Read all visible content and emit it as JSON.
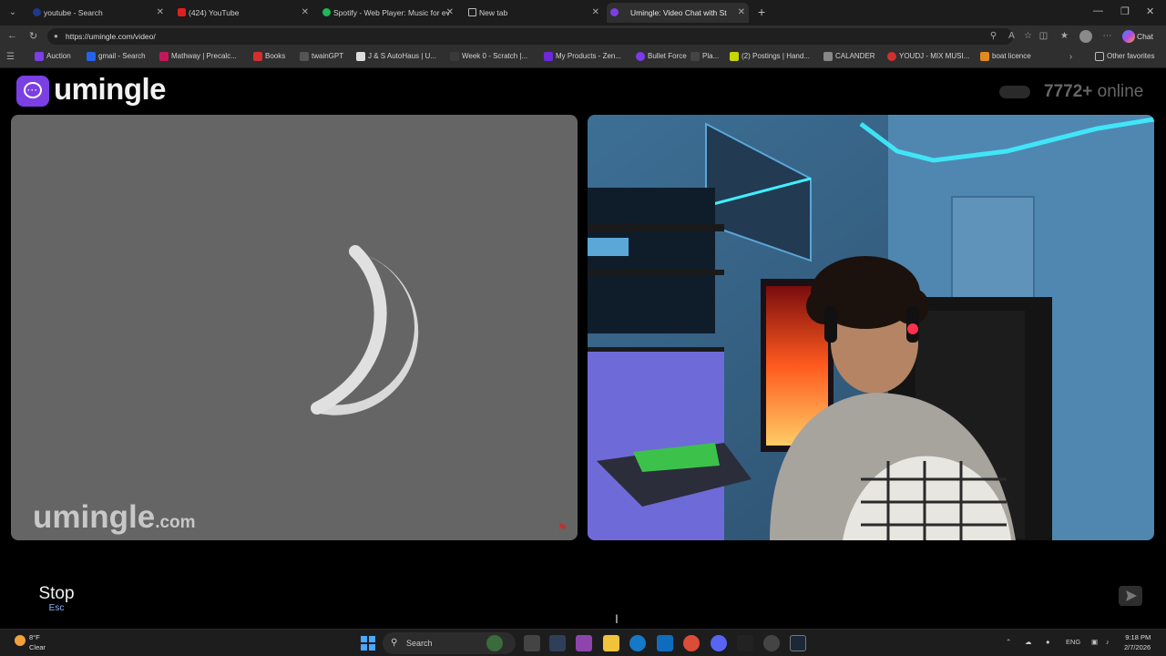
{
  "browser": {
    "tabs": [
      {
        "title": "youtube - Search",
        "active": false
      },
      {
        "title": "(424) YouTube",
        "active": false
      },
      {
        "title": "Spotify - Web Player: Music for ev",
        "active": false
      },
      {
        "title": "New tab",
        "active": false
      },
      {
        "title": "Umingle: Video Chat with St",
        "active": true
      }
    ],
    "url": "https://umingle.com/video/",
    "copilot_label": "Chat",
    "bookmarks": [
      "Auction",
      "gmail - Search",
      "Mathway | Precalc...",
      "Books",
      "twainGPT",
      "J & S AutoHaus | U...",
      "Week 0 - Scratch |...",
      "My Products - Zen...",
      "Bullet Force",
      "Pla...",
      "(2) Postings | Hand...",
      "CALANDER",
      "YOUDJ - MIX MUSI...",
      "boat licence"
    ],
    "other_favorites": "Other favorites"
  },
  "site": {
    "brand": "umingle",
    "online_count": "7772+",
    "online_label": "online",
    "watermark_brand": "umingle",
    "watermark_domain": ".com",
    "stop_label": "Stop",
    "stop_key": "Esc",
    "chat_placeholder": ""
  },
  "taskbar": {
    "weather_temp": "8°F",
    "weather_desc": "Clear",
    "search_label": "Search",
    "lang": "ENG",
    "time": "9:18 PM",
    "date": "2/7/2026"
  },
  "colors": {
    "brand_purple": "#7b3fe4",
    "page_bg": "#000000",
    "stranger_placeholder": "#656565"
  }
}
